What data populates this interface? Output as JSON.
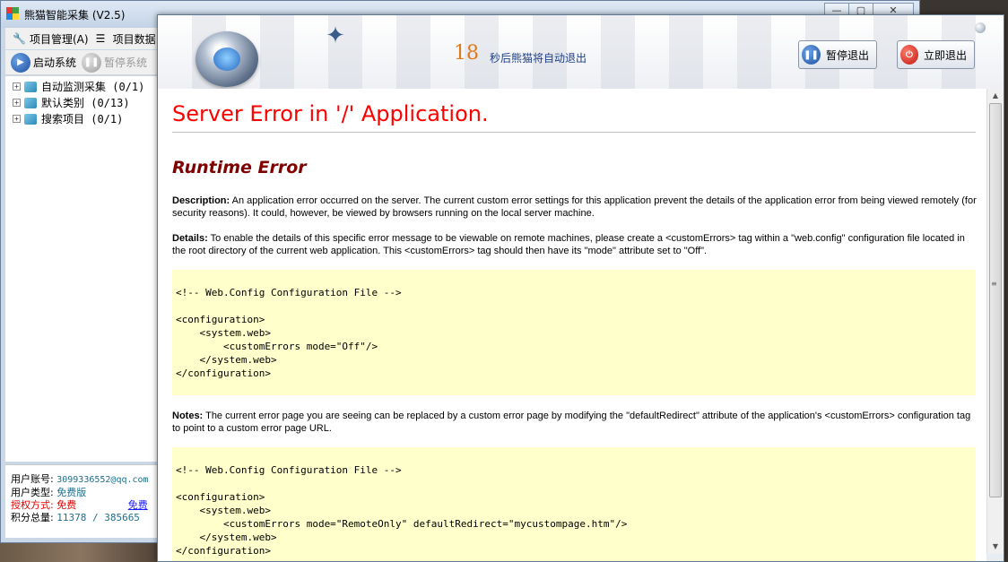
{
  "back_window": {
    "title": "熊猫智能采集 (V2.5)",
    "controls": {
      "minimize": "—",
      "maximize": "▢",
      "close": "✕"
    },
    "menu": [
      {
        "label": "项目管理(A)",
        "icon": "wrench-icon"
      },
      {
        "label": "项目数据",
        "icon": "list-icon"
      }
    ],
    "toolbar": {
      "start_label": "启动系统",
      "pause_label": "暂停系统"
    },
    "tree": [
      {
        "label": "自动监测采集 (0/1)"
      },
      {
        "label": "默认类别 (0/13)"
      },
      {
        "label": "搜索项目 (0/1)"
      }
    ],
    "user": {
      "account_label": "用户账号:",
      "account_value": "3099336552@qq.com",
      "type_label": "用户类型:",
      "type_value": "免费版",
      "auth_label": "授权方式:",
      "auth_value": "免费",
      "auth_extra": "免费",
      "points_label": "积分总量:",
      "points_value": "11378 / 385665"
    }
  },
  "dialog": {
    "countdown_number": "18",
    "countdown_text": "秒后熊猫将自动退出",
    "pause_exit_label": "暂停退出",
    "exit_now_label": "立即退出"
  },
  "page": {
    "title": "Server Error in '/' Application.",
    "subtitle": "Runtime Error",
    "description_label": "Description:",
    "description_text": "An application error occurred on the server. The current custom error settings for this application prevent the details of the application error from being viewed remotely (for security reasons). It could, however, be viewed by browsers running on the local server machine.",
    "details_label": "Details:",
    "details_text": "To enable the details of this specific error message to be viewable on remote machines, please create a <customErrors> tag within a \"web.config\" configuration file located in the root directory of the current web application. This <customErrors> tag should then have its \"mode\" attribute set to \"Off\".",
    "code1": "<!-- Web.Config Configuration File -->\n\n<configuration>\n    <system.web>\n        <customErrors mode=\"Off\"/>\n    </system.web>\n</configuration>",
    "notes_label": "Notes:",
    "notes_text": "The current error page you are seeing can be replaced by a custom error page by modifying the \"defaultRedirect\" attribute of the application's <customErrors> configuration tag to point to a custom error page URL.",
    "code2": "<!-- Web.Config Configuration File -->\n\n<configuration>\n    <system.web>\n        <customErrors mode=\"RemoteOnly\" defaultRedirect=\"mycustompage.htm\"/>\n    </system.web>\n</configuration>"
  }
}
